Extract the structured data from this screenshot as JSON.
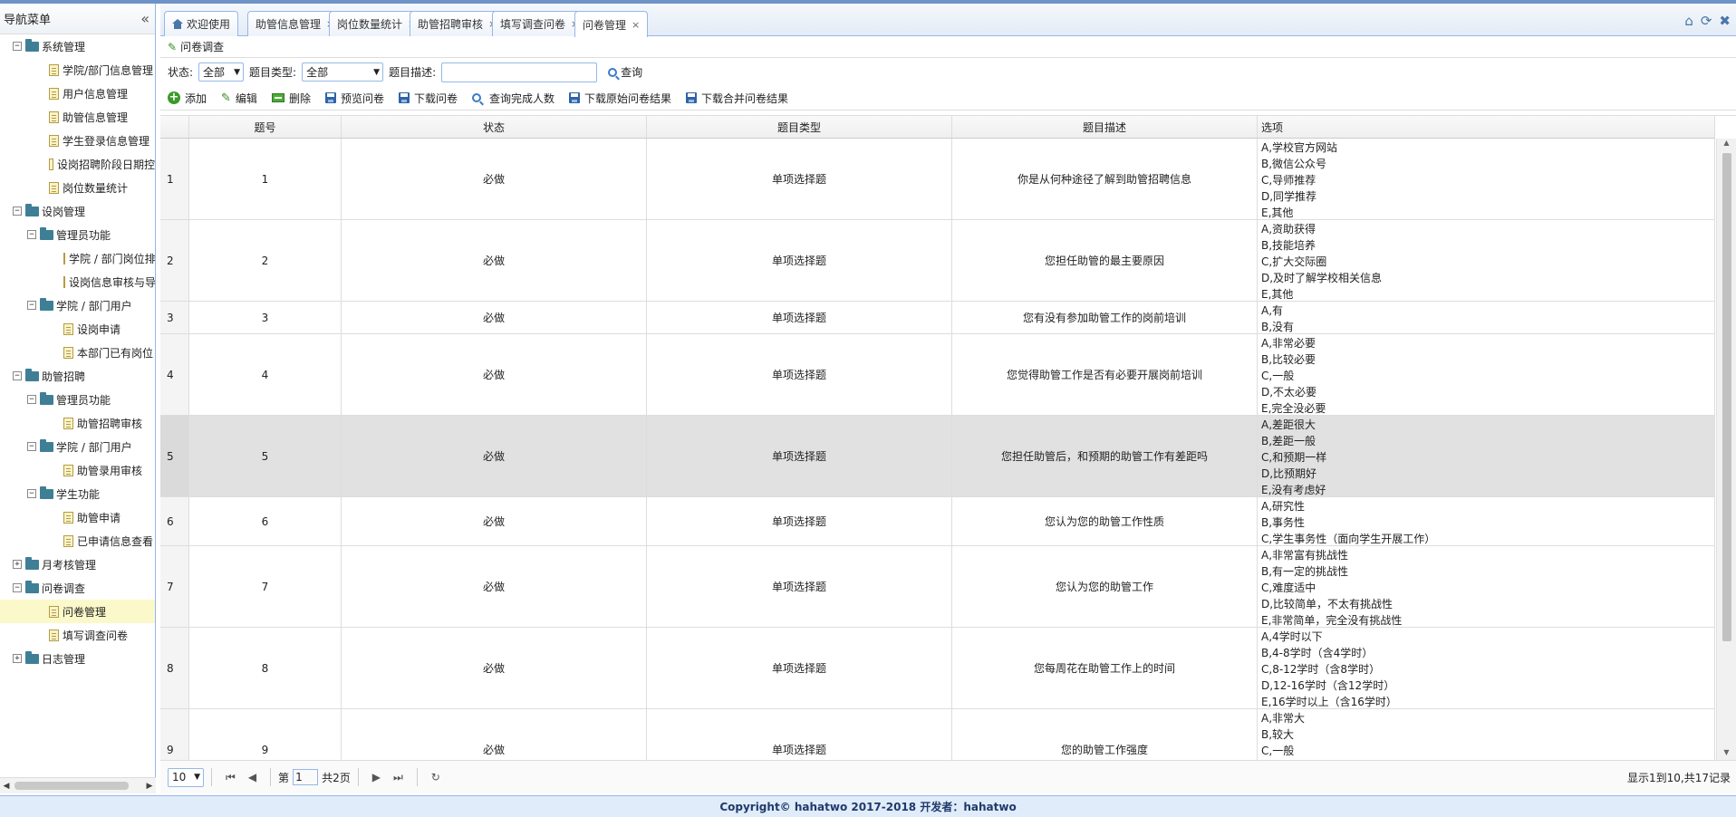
{
  "sidebar": {
    "title": "导航菜单",
    "tree": [
      {
        "label": "系统管理",
        "type": "folder",
        "level": 0,
        "toggle": "−"
      },
      {
        "label": "学院/部门信息管理",
        "type": "leaf",
        "level": 1
      },
      {
        "label": "用户信息管理",
        "type": "leaf",
        "level": 1
      },
      {
        "label": "助管信息管理",
        "type": "leaf",
        "level": 1
      },
      {
        "label": "学生登录信息管理",
        "type": "leaf",
        "level": 1
      },
      {
        "label": "设岗招聘阶段日期控",
        "type": "leaf",
        "level": 1
      },
      {
        "label": "岗位数量统计",
        "type": "leaf",
        "level": 1
      },
      {
        "label": "设岗管理",
        "type": "folder",
        "level": 0,
        "toggle": "−"
      },
      {
        "label": "管理员功能",
        "type": "folder",
        "level": 1,
        "toggle": "−"
      },
      {
        "label": "学院 / 部门岗位排",
        "type": "leaf",
        "level": 2
      },
      {
        "label": "设岗信息审核与导",
        "type": "leaf",
        "level": 2
      },
      {
        "label": "学院 / 部门用户",
        "type": "folder",
        "level": 1,
        "toggle": "−"
      },
      {
        "label": "设岗申请",
        "type": "leaf",
        "level": 2
      },
      {
        "label": "本部门已有岗位",
        "type": "leaf",
        "level": 2
      },
      {
        "label": "助管招聘",
        "type": "folder",
        "level": 0,
        "toggle": "−"
      },
      {
        "label": "管理员功能",
        "type": "folder",
        "level": 1,
        "toggle": "−"
      },
      {
        "label": "助管招聘审核",
        "type": "leaf",
        "level": 2
      },
      {
        "label": "学院 / 部门用户",
        "type": "folder",
        "level": 1,
        "toggle": "−"
      },
      {
        "label": "助管录用审核",
        "type": "leaf",
        "level": 2
      },
      {
        "label": "学生功能",
        "type": "folder",
        "level": 1,
        "toggle": "−"
      },
      {
        "label": "助管申请",
        "type": "leaf",
        "level": 2
      },
      {
        "label": "已申请信息查看",
        "type": "leaf",
        "level": 2
      },
      {
        "label": "月考核管理",
        "type": "folder",
        "level": 0,
        "toggle": "+"
      },
      {
        "label": "问卷调查",
        "type": "folder",
        "level": 0,
        "toggle": "−"
      },
      {
        "label": "问卷管理",
        "type": "leaf",
        "level": 1,
        "selected": true
      },
      {
        "label": "填写调查问卷",
        "type": "leaf",
        "level": 1
      },
      {
        "label": "日志管理",
        "type": "folder",
        "level": 0,
        "toggle": "+"
      }
    ]
  },
  "tabs": [
    {
      "label": "欢迎使用",
      "home": true,
      "closable": false
    },
    {
      "label": "助管信息管理",
      "closable": true
    },
    {
      "label": "岗位数量统计",
      "closable": true
    },
    {
      "label": "助管招聘审核",
      "closable": true
    },
    {
      "label": "填写调查问卷",
      "closable": true
    },
    {
      "label": "问卷管理",
      "closable": true,
      "active": true
    }
  ],
  "panel": {
    "title": "问卷调查"
  },
  "filter": {
    "status_label": "状态:",
    "status_value": "全部",
    "type_label": "题目类型:",
    "type_value": "全部",
    "desc_label": "题目描述:",
    "desc_value": "",
    "query_label": "查询"
  },
  "toolbar": {
    "add": "添加",
    "edit": "编辑",
    "delete": "删除",
    "preview": "预览问卷",
    "download": "下载问卷",
    "query_count": "查询完成人数",
    "download_raw": "下载原始问卷结果",
    "download_merged": "下载合并问卷结果"
  },
  "grid": {
    "headers": [
      "",
      "题号",
      "状态",
      "题目类型",
      "题目描述",
      "选项"
    ],
    "highlight_row": 5,
    "rows": [
      {
        "rn": "1",
        "no": "1",
        "status": "必做",
        "type": "单项选择题",
        "desc": "你是从何种途径了解到助管招聘信息",
        "options": [
          "A,学校官方网站",
          "B,微信公众号",
          "C,导师推荐",
          "D,同学推荐",
          "E,其他"
        ]
      },
      {
        "rn": "2",
        "no": "2",
        "status": "必做",
        "type": "单项选择题",
        "desc": "您担任助管的最主要原因",
        "options": [
          "A,资助获得",
          "B,技能培养",
          "C,扩大交际圈",
          "D,及时了解学校相关信息",
          "E,其他"
        ]
      },
      {
        "rn": "3",
        "no": "3",
        "status": "必做",
        "type": "单项选择题",
        "desc": "您有没有参加助管工作的岗前培训",
        "options": [
          "A,有",
          "B,没有"
        ]
      },
      {
        "rn": "4",
        "no": "4",
        "status": "必做",
        "type": "单项选择题",
        "desc": "您觉得助管工作是否有必要开展岗前培训",
        "options": [
          "A,非常必要",
          "B,比较必要",
          "C,一般",
          "D,不太必要",
          "E,完全没必要"
        ]
      },
      {
        "rn": "5",
        "no": "5",
        "status": "必做",
        "type": "单项选择题",
        "desc": "您担任助管后，和预期的助管工作有差距吗",
        "options": [
          "A,差距很大",
          "B,差距一般",
          "C,和预期一样",
          "D,比预期好",
          "E,没有考虑好"
        ]
      },
      {
        "rn": "6",
        "no": "6",
        "status": "必做",
        "type": "单项选择题",
        "desc": "您认为您的助管工作性质",
        "options": [
          "A,研究性",
          "B,事务性",
          "C,学生事务性（面向学生开展工作）"
        ]
      },
      {
        "rn": "7",
        "no": "7",
        "status": "必做",
        "type": "单项选择题",
        "desc": "您认为您的助管工作",
        "options": [
          "A,非常富有挑战性",
          "B,有一定的挑战性",
          "C,难度适中",
          "D,比较简单，不太有挑战性",
          "E,非常简单，完全没有挑战性"
        ]
      },
      {
        "rn": "8",
        "no": "8",
        "status": "必做",
        "type": "单项选择题",
        "desc": "您每周花在助管工作上的时间",
        "options": [
          "A,4学时以下",
          "B,4-8学时（含4学时）",
          "C,8-12学时（含8学时）",
          "D,12-16学时（含12学时）",
          "E,16学时以上（含16学时）"
        ]
      },
      {
        "rn": "9",
        "no": "9",
        "status": "必做",
        "type": "单项选择题",
        "desc": "您的助管工作强度",
        "options": [
          "A,非常大",
          "B,较大",
          "C,一般"
        ]
      }
    ]
  },
  "pager": {
    "page_size": "10",
    "page_prefix": "第",
    "page_value": "1",
    "page_total": "共2页",
    "info": "显示1到10,共17记录"
  },
  "footer": {
    "copyright": "Copyright© hahatwo 2017-2018 开发者：hahatwo"
  }
}
